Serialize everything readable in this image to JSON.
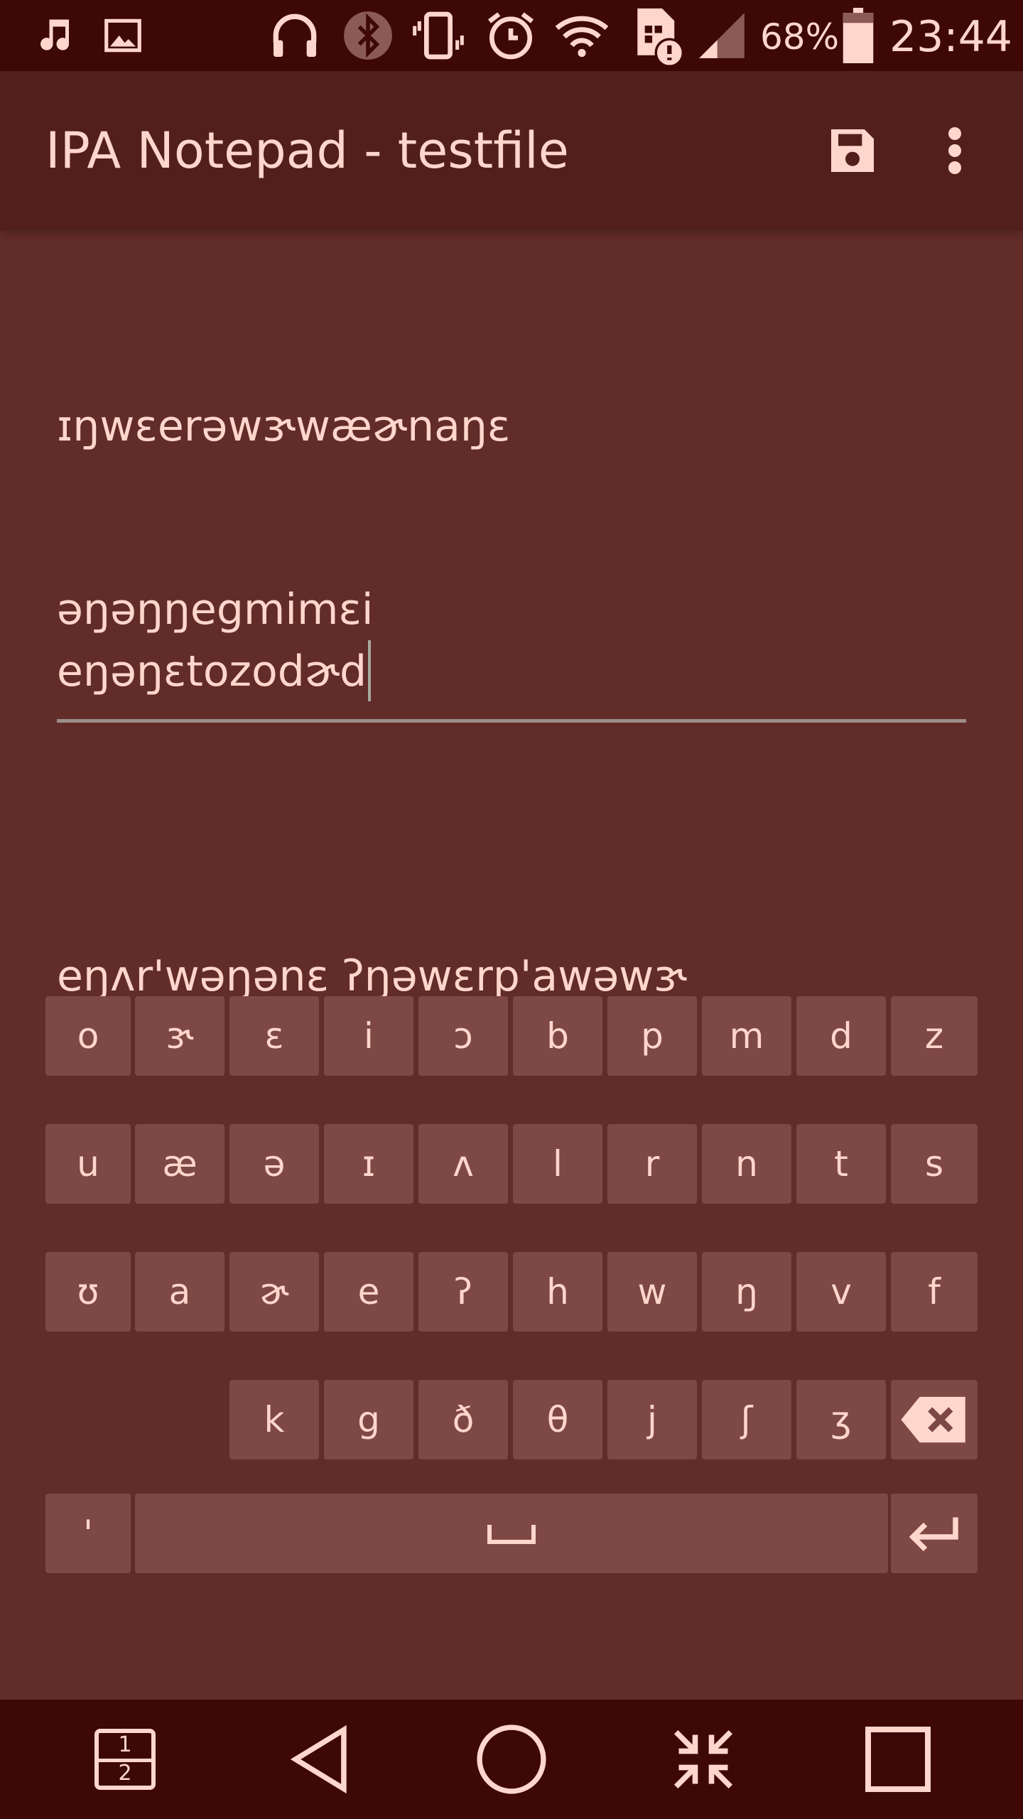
{
  "status_bar": {
    "battery_percent": "68%",
    "time": "23:44",
    "icons": [
      "music-note-icon",
      "image-icon",
      "headphones-icon",
      "bluetooth-icon",
      "vibrate-icon",
      "alarm-icon",
      "wifi-icon",
      "sim-alert-icon",
      "signal-icon",
      "battery-icon"
    ]
  },
  "app_bar": {
    "title": "IPA Notepad - testfile",
    "save_icon": "save-icon",
    "menu_icon": "more-vert-icon"
  },
  "editor": {
    "line1": "ɪŋwɛerəwɝwæɚnaŋɛ",
    "line2": "əŋəŋŋegmimɛi",
    "line3": "",
    "line4": "eŋʌr'wəŋənɛ ʔŋəwɛrp'awəwɝ",
    "current_input": "eŋəŋɛtozodɚd"
  },
  "keyboard": {
    "row1": [
      "o",
      "ɝ",
      "ɛ",
      "i",
      "ɔ",
      "b",
      "p",
      "m",
      "d",
      "z"
    ],
    "row2": [
      "u",
      "æ",
      "ə",
      "ɪ",
      "ʌ",
      "l",
      "r",
      "n",
      "t",
      "s"
    ],
    "row3": [
      "ʊ",
      "a",
      "ɚ",
      "e",
      "ʔ",
      "h",
      "w",
      "ŋ",
      "v",
      "f"
    ],
    "row4": [
      "k",
      "g",
      "ð",
      "θ",
      "j",
      "ʃ",
      "ʒ"
    ],
    "row5_apostrophe": "'",
    "space_symbol": "␣",
    "backspace_icon": "backspace-icon",
    "enter_icon": "enter-icon"
  },
  "nav_bar": {
    "icons": [
      "dual-window-icon",
      "back-icon",
      "home-icon",
      "shrink-icon",
      "recents-icon"
    ],
    "dual_window_labels": [
      "1",
      "2"
    ]
  }
}
